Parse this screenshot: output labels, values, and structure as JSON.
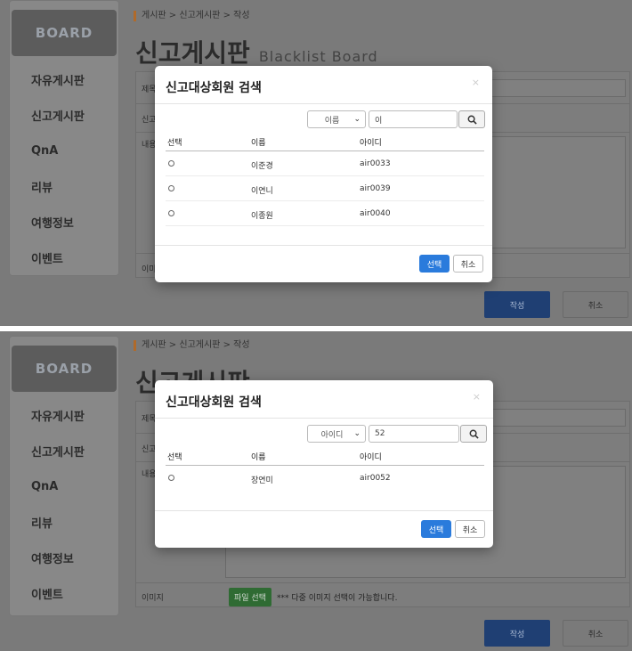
{
  "sidebar": {
    "header": "BOARD",
    "items": [
      "자유게시판",
      "신고게시판",
      "QnA",
      "리뷰",
      "여행정보",
      "이벤트"
    ]
  },
  "breadcrumb": {
    "root": "게시판",
    "sep": ">",
    "parent": "신고게시판",
    "current": "작성"
  },
  "page_title": {
    "main": "신고게시판",
    "sub": "Blacklist Board"
  },
  "form": {
    "title_label": "제목",
    "target_label": "신고",
    "content_label": "내용",
    "image_label": "이미지",
    "file_button": "파일 선택",
    "file_note": "*** 다중 이미지 선택이 가능합니다.",
    "submit": "작성",
    "cancel": "취소"
  },
  "modal": {
    "title": "신고대상회원 검색",
    "close": "×",
    "columns": [
      "선택",
      "이름",
      "아이디"
    ],
    "select_button": "선택",
    "cancel_button": "취소"
  },
  "screen1": {
    "search_field": "이름",
    "search_value": "이",
    "results": [
      {
        "name": "이준경",
        "id": "air0033"
      },
      {
        "name": "이연니",
        "id": "air0039"
      },
      {
        "name": "이종원",
        "id": "air0040"
      }
    ]
  },
  "screen2": {
    "search_field": "아이디",
    "search_value": "52",
    "results": [
      {
        "name": "장연미",
        "id": "air0052"
      }
    ]
  },
  "colors": {
    "primary": "#2a7bdc",
    "overlay": "#7a7a7a",
    "file_button": "#2f6b33",
    "breadcrumb_accent": "#b06a2a"
  }
}
